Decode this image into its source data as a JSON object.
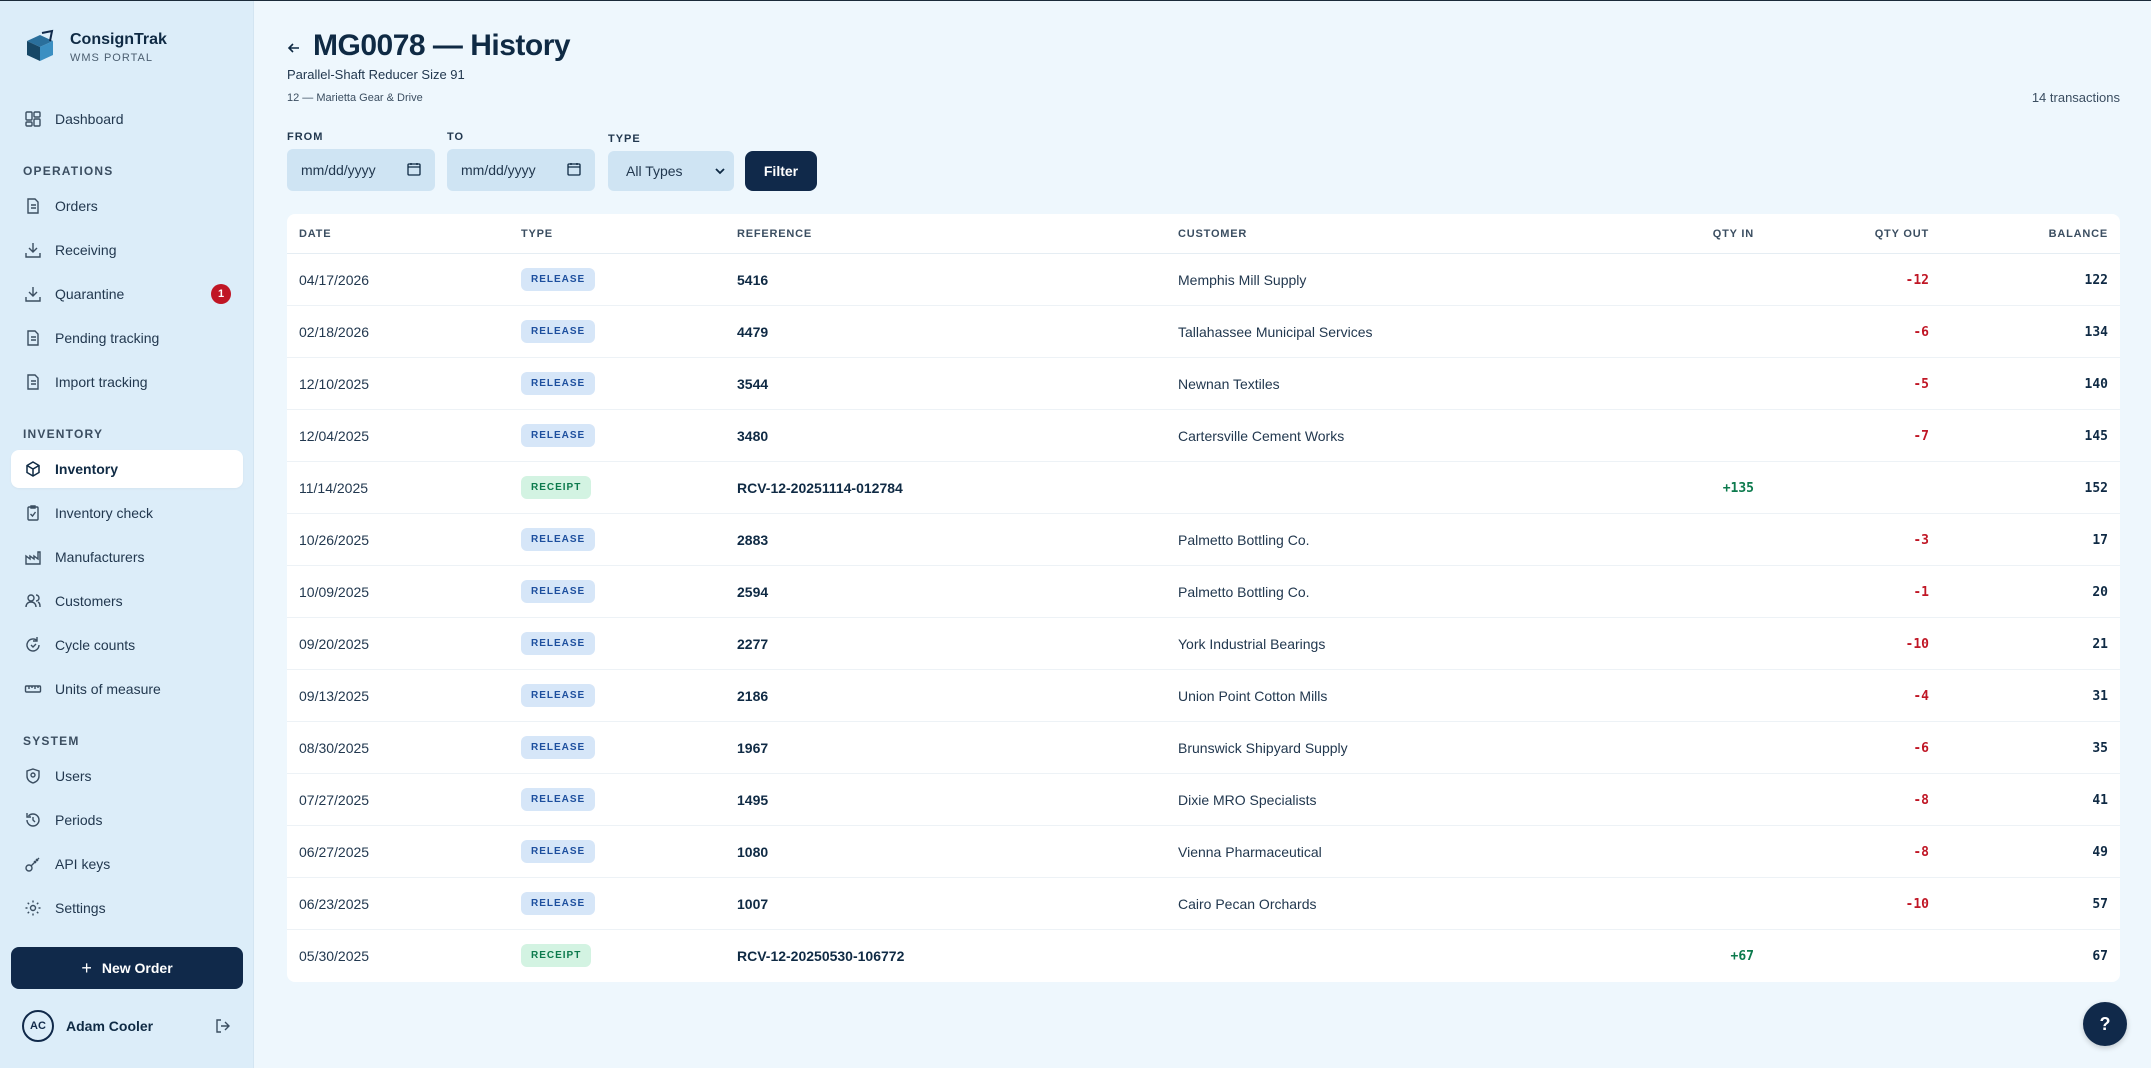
{
  "brand": {
    "name": "ConsignTrak",
    "sub": "WMS PORTAL",
    "icon": "box-logo-icon"
  },
  "nav": {
    "dashboard": "Dashboard",
    "sections": {
      "operations": "OPERATIONS",
      "inventory": "INVENTORY",
      "system": "SYSTEM"
    },
    "operations": [
      "Orders",
      "Receiving",
      "Quarantine",
      "Pending tracking",
      "Import tracking"
    ],
    "quarantine_badge": "1",
    "inventory": [
      "Inventory",
      "Inventory check",
      "Manufacturers",
      "Customers",
      "Cycle counts",
      "Units of measure"
    ],
    "system": [
      "Users",
      "Periods",
      "API keys",
      "Settings"
    ],
    "active": "Inventory"
  },
  "new_order_label": "New Order",
  "user": {
    "initials": "AC",
    "name": "Adam Cooler"
  },
  "page": {
    "title": "MG0078 — History",
    "subtitle": "Parallel-Shaft Reducer Size 91",
    "client": "12 — Marietta Gear & Drive",
    "tx_count": "14 transactions"
  },
  "filters": {
    "from_label": "FROM",
    "to_label": "TO",
    "type_label": "TYPE",
    "from_placeholder": "mm/dd/yyyy",
    "to_placeholder": "mm/dd/yyyy",
    "type_value": "All Types",
    "button": "Filter"
  },
  "table": {
    "headers": {
      "date": "DATE",
      "type": "TYPE",
      "reference": "REFERENCE",
      "customer": "CUSTOMER",
      "qty_in": "QTY IN",
      "qty_out": "QTY OUT",
      "balance": "BALANCE"
    },
    "rows": [
      {
        "date": "04/17/2026",
        "type": "RELEASE",
        "reference": "5416",
        "customer": "Memphis Mill Supply",
        "qty_in": "",
        "qty_out": "-12",
        "balance": "122"
      },
      {
        "date": "02/18/2026",
        "type": "RELEASE",
        "reference": "4479",
        "customer": "Tallahassee Municipal Services",
        "qty_in": "",
        "qty_out": "-6",
        "balance": "134"
      },
      {
        "date": "12/10/2025",
        "type": "RELEASE",
        "reference": "3544",
        "customer": "Newnan Textiles",
        "qty_in": "",
        "qty_out": "-5",
        "balance": "140"
      },
      {
        "date": "12/04/2025",
        "type": "RELEASE",
        "reference": "3480",
        "customer": "Cartersville Cement Works",
        "qty_in": "",
        "qty_out": "-7",
        "balance": "145"
      },
      {
        "date": "11/14/2025",
        "type": "RECEIPT",
        "reference": "RCV-12-20251114-012784",
        "customer": "",
        "qty_in": "+135",
        "qty_out": "",
        "balance": "152"
      },
      {
        "date": "10/26/2025",
        "type": "RELEASE",
        "reference": "2883",
        "customer": "Palmetto Bottling Co.",
        "qty_in": "",
        "qty_out": "-3",
        "balance": "17"
      },
      {
        "date": "10/09/2025",
        "type": "RELEASE",
        "reference": "2594",
        "customer": "Palmetto Bottling Co.",
        "qty_in": "",
        "qty_out": "-1",
        "balance": "20"
      },
      {
        "date": "09/20/2025",
        "type": "RELEASE",
        "reference": "2277",
        "customer": "York Industrial Bearings",
        "qty_in": "",
        "qty_out": "-10",
        "balance": "21"
      },
      {
        "date": "09/13/2025",
        "type": "RELEASE",
        "reference": "2186",
        "customer": "Union Point Cotton Mills",
        "qty_in": "",
        "qty_out": "-4",
        "balance": "31"
      },
      {
        "date": "08/30/2025",
        "type": "RELEASE",
        "reference": "1967",
        "customer": "Brunswick Shipyard Supply",
        "qty_in": "",
        "qty_out": "-6",
        "balance": "35"
      },
      {
        "date": "07/27/2025",
        "type": "RELEASE",
        "reference": "1495",
        "customer": "Dixie MRO Specialists",
        "qty_in": "",
        "qty_out": "-8",
        "balance": "41"
      },
      {
        "date": "06/27/2025",
        "type": "RELEASE",
        "reference": "1080",
        "customer": "Vienna Pharmaceutical",
        "qty_in": "",
        "qty_out": "-8",
        "balance": "49"
      },
      {
        "date": "06/23/2025",
        "type": "RELEASE",
        "reference": "1007",
        "customer": "Cairo Pecan Orchards",
        "qty_in": "",
        "qty_out": "-10",
        "balance": "57"
      },
      {
        "date": "05/30/2025",
        "type": "RECEIPT",
        "reference": "RCV-12-20250530-106772",
        "customer": "",
        "qty_in": "+67",
        "qty_out": "",
        "balance": "67"
      }
    ]
  },
  "help_label": "?",
  "colors": {
    "primary": "#10294a",
    "sidebar_bg": "#dcedf9",
    "page_bg": "#eef7fd",
    "negative": "#c01625",
    "positive": "#0c7a4d"
  }
}
